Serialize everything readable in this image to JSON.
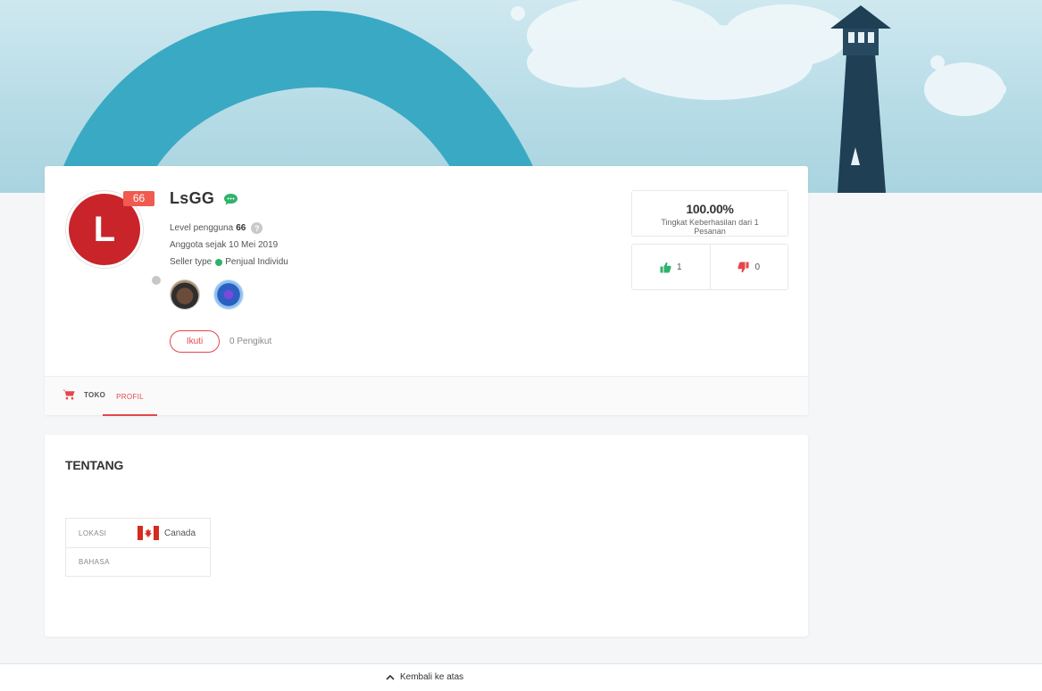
{
  "profile": {
    "avatar_letter": "L",
    "level_badge": "66",
    "username": "LsGG",
    "level_label": "Level pengguna",
    "level_value": "66",
    "help_glyph": "?",
    "member_since": "Anggota sejak 10 Mei 2019",
    "seller_type_label": "Seller type",
    "seller_type_value": "Penjual Individu",
    "follow_label": "Ikuti",
    "followers": "0 Pengikut",
    "icons": {
      "chat": "chat-bubble-icon",
      "help": "question-icon",
      "verified": "check-circle-icon"
    }
  },
  "stats": {
    "success_rate": "100.00%",
    "success_label": "Tingkat Keberhasilan dari 1 Pesanan",
    "thumbs_up": "1",
    "thumbs_down": "0"
  },
  "tabs": {
    "shop": "TOKO",
    "profile": "PROFIL"
  },
  "about": {
    "title": "TENTANG",
    "rows": [
      {
        "key": "LOKASI",
        "value": "Canada"
      },
      {
        "key": "BAHASA",
        "value": ""
      }
    ]
  },
  "footer": {
    "back_to_top": "Kembali ke atas"
  },
  "colors": {
    "accent": "#e5464b",
    "badge": "#f05a50",
    "avatar": "#c8242a",
    "verified": "#2fb36a",
    "banner_arc": "#3aa9c4"
  }
}
